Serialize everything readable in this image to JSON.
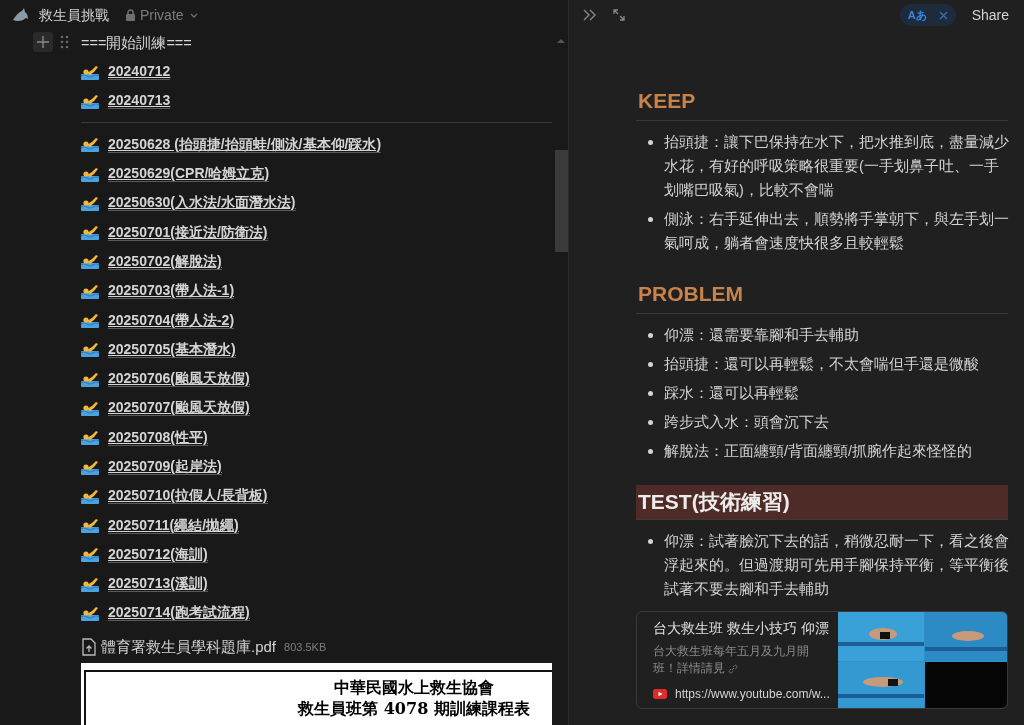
{
  "page": {
    "title": "救生員挑戰",
    "visibility": "Private"
  },
  "outline": {
    "heading": "===開始訓練===",
    "page_groups": [
      {
        "pages": [
          {
            "title": "20240712"
          },
          {
            "title": "20240713"
          }
        ]
      },
      {
        "pages": [
          {
            "title": "20250628 (抬頭捷/抬頭蛙/側泳/基本仰/踩水)"
          },
          {
            "title": "20250629(CPR/哈姆立克)"
          },
          {
            "title": "20250630(入水法/水面潛水法)"
          },
          {
            "title": "20250701(接近法/防衛法)"
          },
          {
            "title": "20250702(解脫法)"
          },
          {
            "title": "20250703(帶人法-1)"
          },
          {
            "title": "20250704(帶人法-2)"
          },
          {
            "title": "20250705(基本潛水)"
          },
          {
            "title": "20250706(颱風天放假)"
          },
          {
            "title": "20250707(颱風天放假)"
          },
          {
            "title": "20250708(性平)"
          },
          {
            "title": "20250709(起岸法)"
          },
          {
            "title": "20250710(拉假人/長背板)"
          },
          {
            "title": "20250711(繩結/拋繩)"
          },
          {
            "title": "20250712(海訓)"
          },
          {
            "title": "20250713(溪訓)"
          },
          {
            "title": "20250714(跑考試流程)"
          }
        ]
      }
    ],
    "attachment": {
      "name": "體育署救生員學科題庫.pdf",
      "size": "803.5KB"
    },
    "document_preview": {
      "lines": [
        "中華民國水上救生協會",
        "救生員班第 4078 期訓練課程表"
      ]
    }
  },
  "toolbar": {
    "translate_label": "Aあ",
    "share": "Share"
  },
  "sections": [
    {
      "heading": "KEEP",
      "kind": "orange",
      "items": [
        "抬頭捷：讓下巴保持在水下，把水推到底，盡量減少水花，有好的呼吸策略很重要(一手划鼻子吐、一手划嘴巴吸氣)，比較不會喘",
        "側泳：右手延伸出去，順勢將手掌朝下，與左手划一氣呵成，躺者會速度快很多且較輕鬆"
      ]
    },
    {
      "heading": "PROBLEM",
      "kind": "orange",
      "items": [
        "仰漂：還需要靠腳和手去輔助",
        "抬頭捷：還可以再輕鬆，不太會喘但手還是微酸",
        "踩水：還可以再輕鬆",
        "跨步式入水：頭會沉下去",
        "解脫法：正面纏頸/背面纏頸/抓腕作起來怪怪的"
      ]
    },
    {
      "heading": "TEST(技術練習)",
      "kind": "highlight",
      "items": [
        "仰漂：試著臉沉下去的話，稍微忍耐一下，看之後會浮起來的。但過渡期可先用手腳保持平衡，等平衡後試著不要去腳和手去輔助"
      ]
    }
  ],
  "bookmark": {
    "title": "台大救生班 救生小技巧 仰漂",
    "description": "台大救生班每年五月及九月開班！詳情請見",
    "url": "https://www.youtube.com/w..."
  }
}
